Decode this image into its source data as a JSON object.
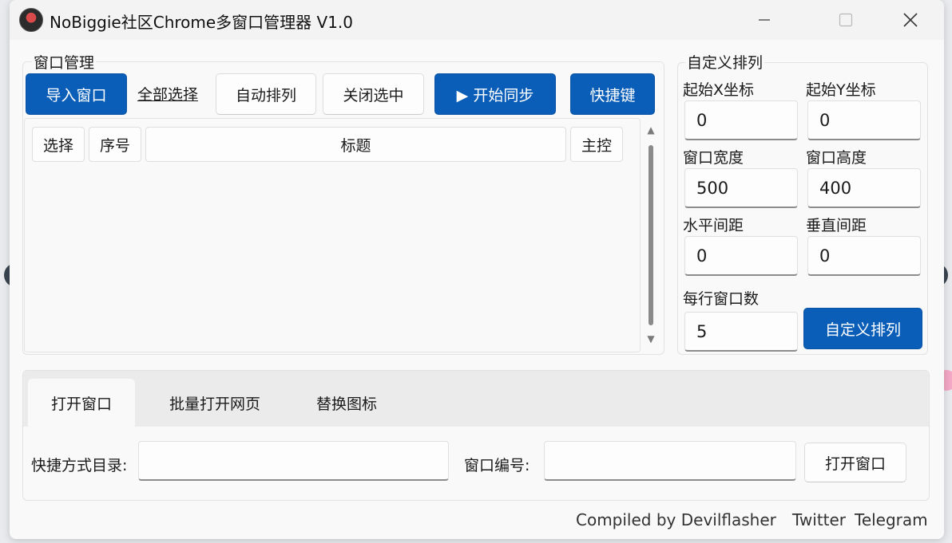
{
  "window": {
    "title": "NoBiggie社区Chrome多窗口管理器 V1.0"
  },
  "window_management": {
    "legend": "窗口管理",
    "toolbar": {
      "import_label": "导入窗口",
      "select_all_label": "全部选择",
      "auto_arrange_label": "自动排列",
      "close_selected_label": "关闭选中",
      "start_sync_label": "▶ 开始同步",
      "hotkey_label": "快捷键"
    },
    "table": {
      "columns": [
        "选择",
        "序号",
        "标题",
        "主控"
      ],
      "rows": []
    }
  },
  "custom_arrange": {
    "legend": "自定义排列",
    "start_x": {
      "label": "起始X坐标",
      "value": "0"
    },
    "start_y": {
      "label": "起始Y坐标",
      "value": "0"
    },
    "width": {
      "label": "窗口宽度",
      "value": "500"
    },
    "height": {
      "label": "窗口高度",
      "value": "400"
    },
    "h_gap": {
      "label": "水平间距",
      "value": "0"
    },
    "v_gap": {
      "label": "垂直间距",
      "value": "0"
    },
    "per_row": {
      "label": "每行窗口数",
      "value": "5"
    },
    "apply_label": "自定义排列"
  },
  "tabs": {
    "items": [
      {
        "label": "打开窗口",
        "active": true
      },
      {
        "label": "批量打开网页",
        "active": false
      },
      {
        "label": "替换图标",
        "active": false
      }
    ],
    "open_window": {
      "shortcut_dir_label": "快捷方式目录:",
      "shortcut_dir_value": "",
      "window_number_label": "窗口编号:",
      "window_number_value": "",
      "open_button_label": "打开窗口"
    }
  },
  "footer": {
    "compiled_by": "Compiled by Devilflasher",
    "twitter": "Twitter",
    "telegram": "Telegram"
  },
  "colors": {
    "primary": "#0a5eb8",
    "window_bg": "#f9f9f9",
    "titlebar_bg": "#f3f3f3"
  }
}
